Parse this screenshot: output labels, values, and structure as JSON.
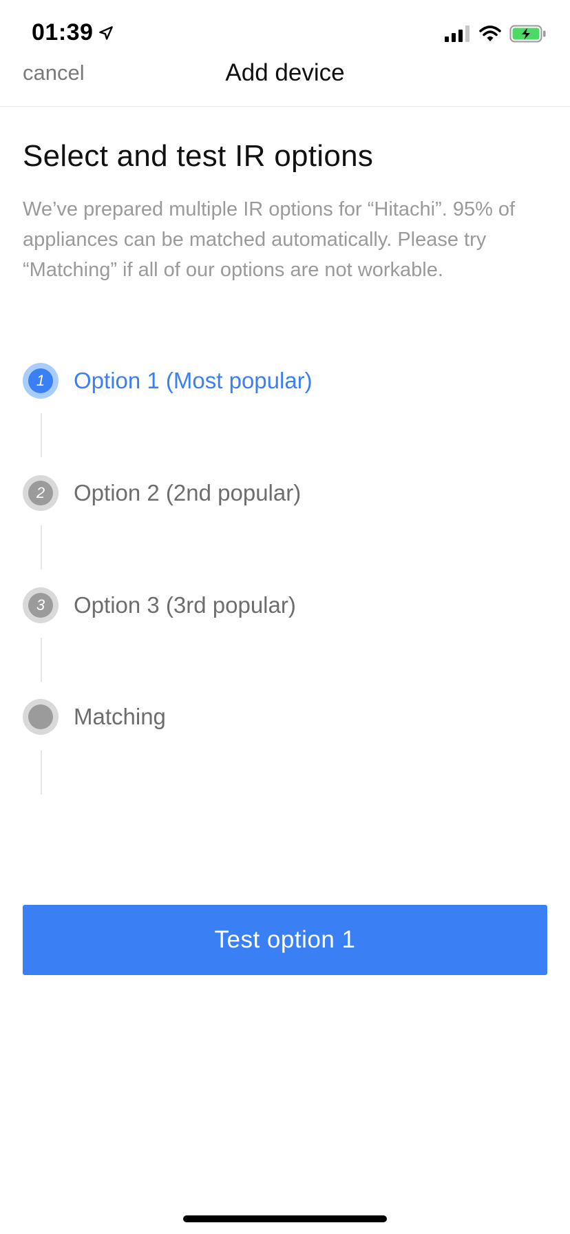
{
  "status_bar": {
    "time": "01:39",
    "icons": [
      "location-arrow-icon",
      "signal-icon",
      "wifi-icon",
      "battery-charging-icon"
    ],
    "battery_color": "#4cd964"
  },
  "nav": {
    "cancel_label": "cancel",
    "title": "Add device"
  },
  "page": {
    "title": "Select and test IR options",
    "description": "We’ve prepared multiple IR options for “Hitachi”. 95% of appliances can be matched automatically. Please try “Matching” if all of our options are not workable."
  },
  "steps": [
    {
      "number": "1",
      "label": "Option 1 (Most popular)",
      "active": true
    },
    {
      "number": "2",
      "label": "Option 2 (2nd popular)",
      "active": false
    },
    {
      "number": "3",
      "label": "Option 3 (3rd popular)",
      "active": false
    },
    {
      "number": "",
      "label": "Matching",
      "active": false
    }
  ],
  "primary_action": {
    "label": "Test option 1"
  },
  "colors": {
    "accent": "#3a7ff3",
    "accent_light": "#a9cdfb",
    "inactive": "#9b9b9b",
    "muted_text": "#9a9a9a"
  }
}
